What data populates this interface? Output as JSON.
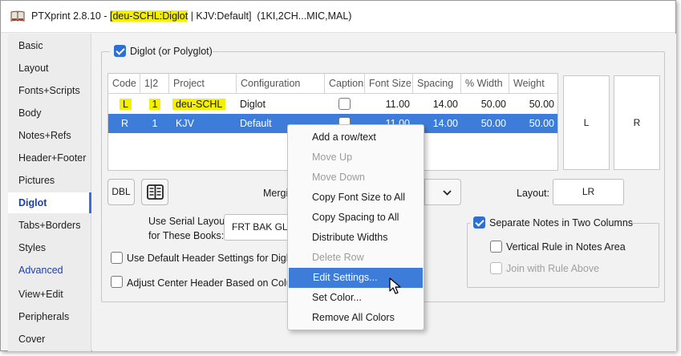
{
  "titlebar": {
    "app_name": "PTXprint 2.8.10",
    "sep": " - ",
    "highlight": "[deu-SCHL:Diglot",
    "rest": " | KJV:Default]  (1KI,2CH...MIC,MAL)"
  },
  "sidebar": {
    "items": [
      {
        "label": "Basic"
      },
      {
        "label": "Layout"
      },
      {
        "label": "Fonts+Scripts"
      },
      {
        "label": "Body"
      },
      {
        "label": "Notes+Refs"
      },
      {
        "label": "Header+Footer"
      },
      {
        "label": "Pictures"
      },
      {
        "label": "Diglot"
      },
      {
        "label": "Tabs+Borders"
      },
      {
        "label": "Styles"
      },
      {
        "label": "Advanced"
      },
      {
        "label": "View+Edit"
      },
      {
        "label": "Peripherals"
      },
      {
        "label": "Cover"
      }
    ]
  },
  "diglot": {
    "enable_label": "Diglot (or Polyglot)",
    "enable_checked": true,
    "columns": [
      "Code",
      "1|2",
      "Project",
      "Configuration",
      "Captions",
      "Font Size",
      "Spacing",
      "% Width",
      "Weight"
    ],
    "rows": [
      {
        "code": "L",
        "side": "1",
        "project": "deu-SCHL",
        "config": "Diglot",
        "captions": false,
        "font_size": "11.00",
        "spacing": "14.00",
        "width": "50.00",
        "weight": "50.00"
      },
      {
        "code": "R",
        "side": "1",
        "project": "KJV",
        "config": "Default",
        "captions": false,
        "font_size": "11.00",
        "spacing": "14.00",
        "width": "50.00",
        "weight": "50.00"
      }
    ],
    "preview_left": "L",
    "preview_right": "R",
    "dbl_button": "DBL",
    "merge_label": "Mergi",
    "layout_label": "Layout:",
    "layout_value": "LR",
    "serial_label_line1": "Use Serial Layout",
    "serial_label_line2": "for These Books:",
    "serial_value": "FRT BAK GLO",
    "use_default_header_label": "Use Default Header Settings for Diglot",
    "adjust_center_header_label": "Adjust Center Header Based on Colum",
    "separate_notes_label": "Separate Notes in Two Columns",
    "separate_notes_checked": true,
    "vertical_rule_label": "Vertical Rule in Notes Area",
    "join_rule_label": "Join with Rule Above"
  },
  "context_menu": {
    "items": [
      {
        "label": "Add a row/text",
        "state": "normal"
      },
      {
        "label": "Move Up",
        "state": "disabled"
      },
      {
        "label": "Move Down",
        "state": "disabled"
      },
      {
        "label": "Copy Font Size to All",
        "state": "normal"
      },
      {
        "label": "Copy Spacing to All",
        "state": "normal"
      },
      {
        "label": "Distribute Widths",
        "state": "normal"
      },
      {
        "label": "Delete Row",
        "state": "disabled"
      },
      {
        "label": "Edit Settings...",
        "state": "hover"
      },
      {
        "label": "Set Color...",
        "state": "normal"
      },
      {
        "label": "Remove All Colors",
        "state": "normal"
      }
    ]
  },
  "colors": {
    "accent": "#3d7dd9",
    "highlight_yellow": "#f5f000",
    "sidebar_active_text": "#1f3fa8"
  }
}
